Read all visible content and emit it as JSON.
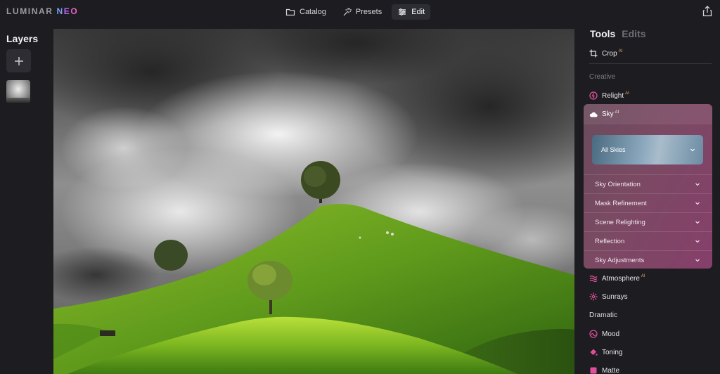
{
  "app": {
    "logo_main": "LUMINAR",
    "logo_accent": "NEO"
  },
  "nav": {
    "catalog": "Catalog",
    "presets": "Presets",
    "edit": "Edit",
    "active": "Edit"
  },
  "layers": {
    "title": "Layers"
  },
  "panel": {
    "tabs": [
      {
        "label": "Tools",
        "active": true
      },
      {
        "label": "Edits",
        "active": false
      }
    ],
    "crop": {
      "label": "Crop",
      "badge": "AI"
    },
    "section_creative": "Creative",
    "relight": {
      "label": "Relight",
      "badge": "AI"
    },
    "sky": {
      "label": "Sky",
      "badge": "AI",
      "select_value": "All Skies",
      "subsections": [
        "Sky Orientation",
        "Mask Refinement",
        "Scene Relighting",
        "Reflection",
        "Sky Adjustments"
      ]
    },
    "atmosphere": {
      "label": "Atmosphere",
      "badge": "AI"
    },
    "sunrays": {
      "label": "Sunrays"
    },
    "section_dramatic": "Dramatic",
    "mood": {
      "label": "Mood"
    },
    "toning": {
      "label": "Toning"
    },
    "matte": {
      "label": "Matte"
    }
  },
  "colors": {
    "background": "#1d1d21",
    "sky_card": "#7a4a63",
    "ai_badge": "#e3a56a",
    "icon_pink": "#e0509a"
  }
}
